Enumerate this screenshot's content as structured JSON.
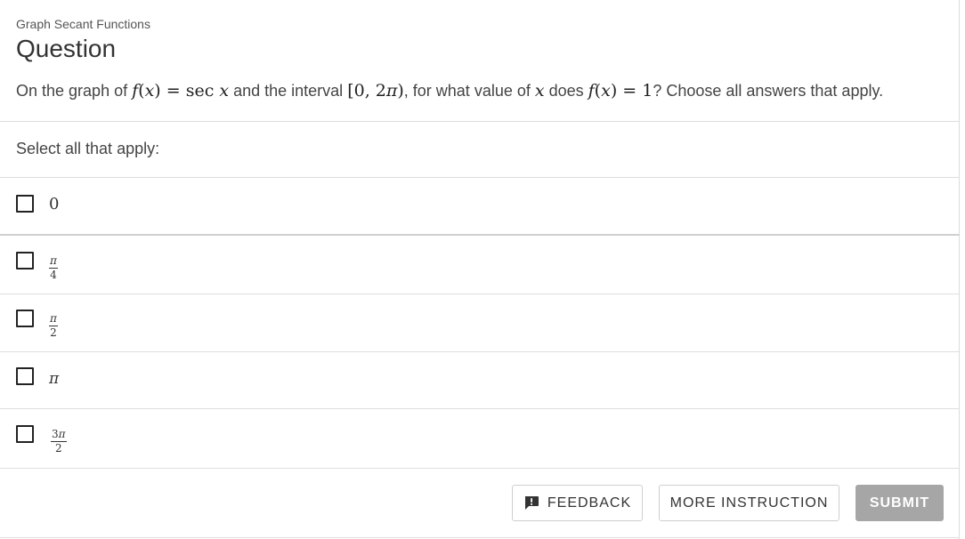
{
  "header": {
    "breadcrumb": "Graph Secant Functions",
    "title": "Question"
  },
  "question": {
    "text_1": "On the graph of ",
    "math_1": "f(x) = sec x",
    "text_2": " and the interval ",
    "math_2": "[0, 2π)",
    "text_3": ", for what value of ",
    "math_3": "x",
    "text_4": " does ",
    "math_4": "f(x) = 1",
    "text_5": "? Choose all answers that apply."
  },
  "select_label": "Select all that apply:",
  "options": [
    {
      "label": "0",
      "checked": false
    },
    {
      "label": "π/4",
      "numerator": "π",
      "denominator": "4",
      "checked": false
    },
    {
      "label": "π/2",
      "numerator": "π",
      "denominator": "2",
      "checked": false
    },
    {
      "label": "π",
      "checked": false
    },
    {
      "label": "3π/2",
      "numerator_coef": "3",
      "numerator": "π",
      "denominator": "2",
      "checked": false
    }
  ],
  "buttons": {
    "feedback": "FEEDBACK",
    "more_instruction": "MORE INSTRUCTION",
    "submit": "SUBMIT"
  },
  "icons": {
    "feedback": "feedback-icon",
    "checkbox": "checkbox-empty"
  },
  "colors": {
    "submit_disabled_bg": "#a6a6a6",
    "divider": "#dedede",
    "text": "#333333"
  }
}
